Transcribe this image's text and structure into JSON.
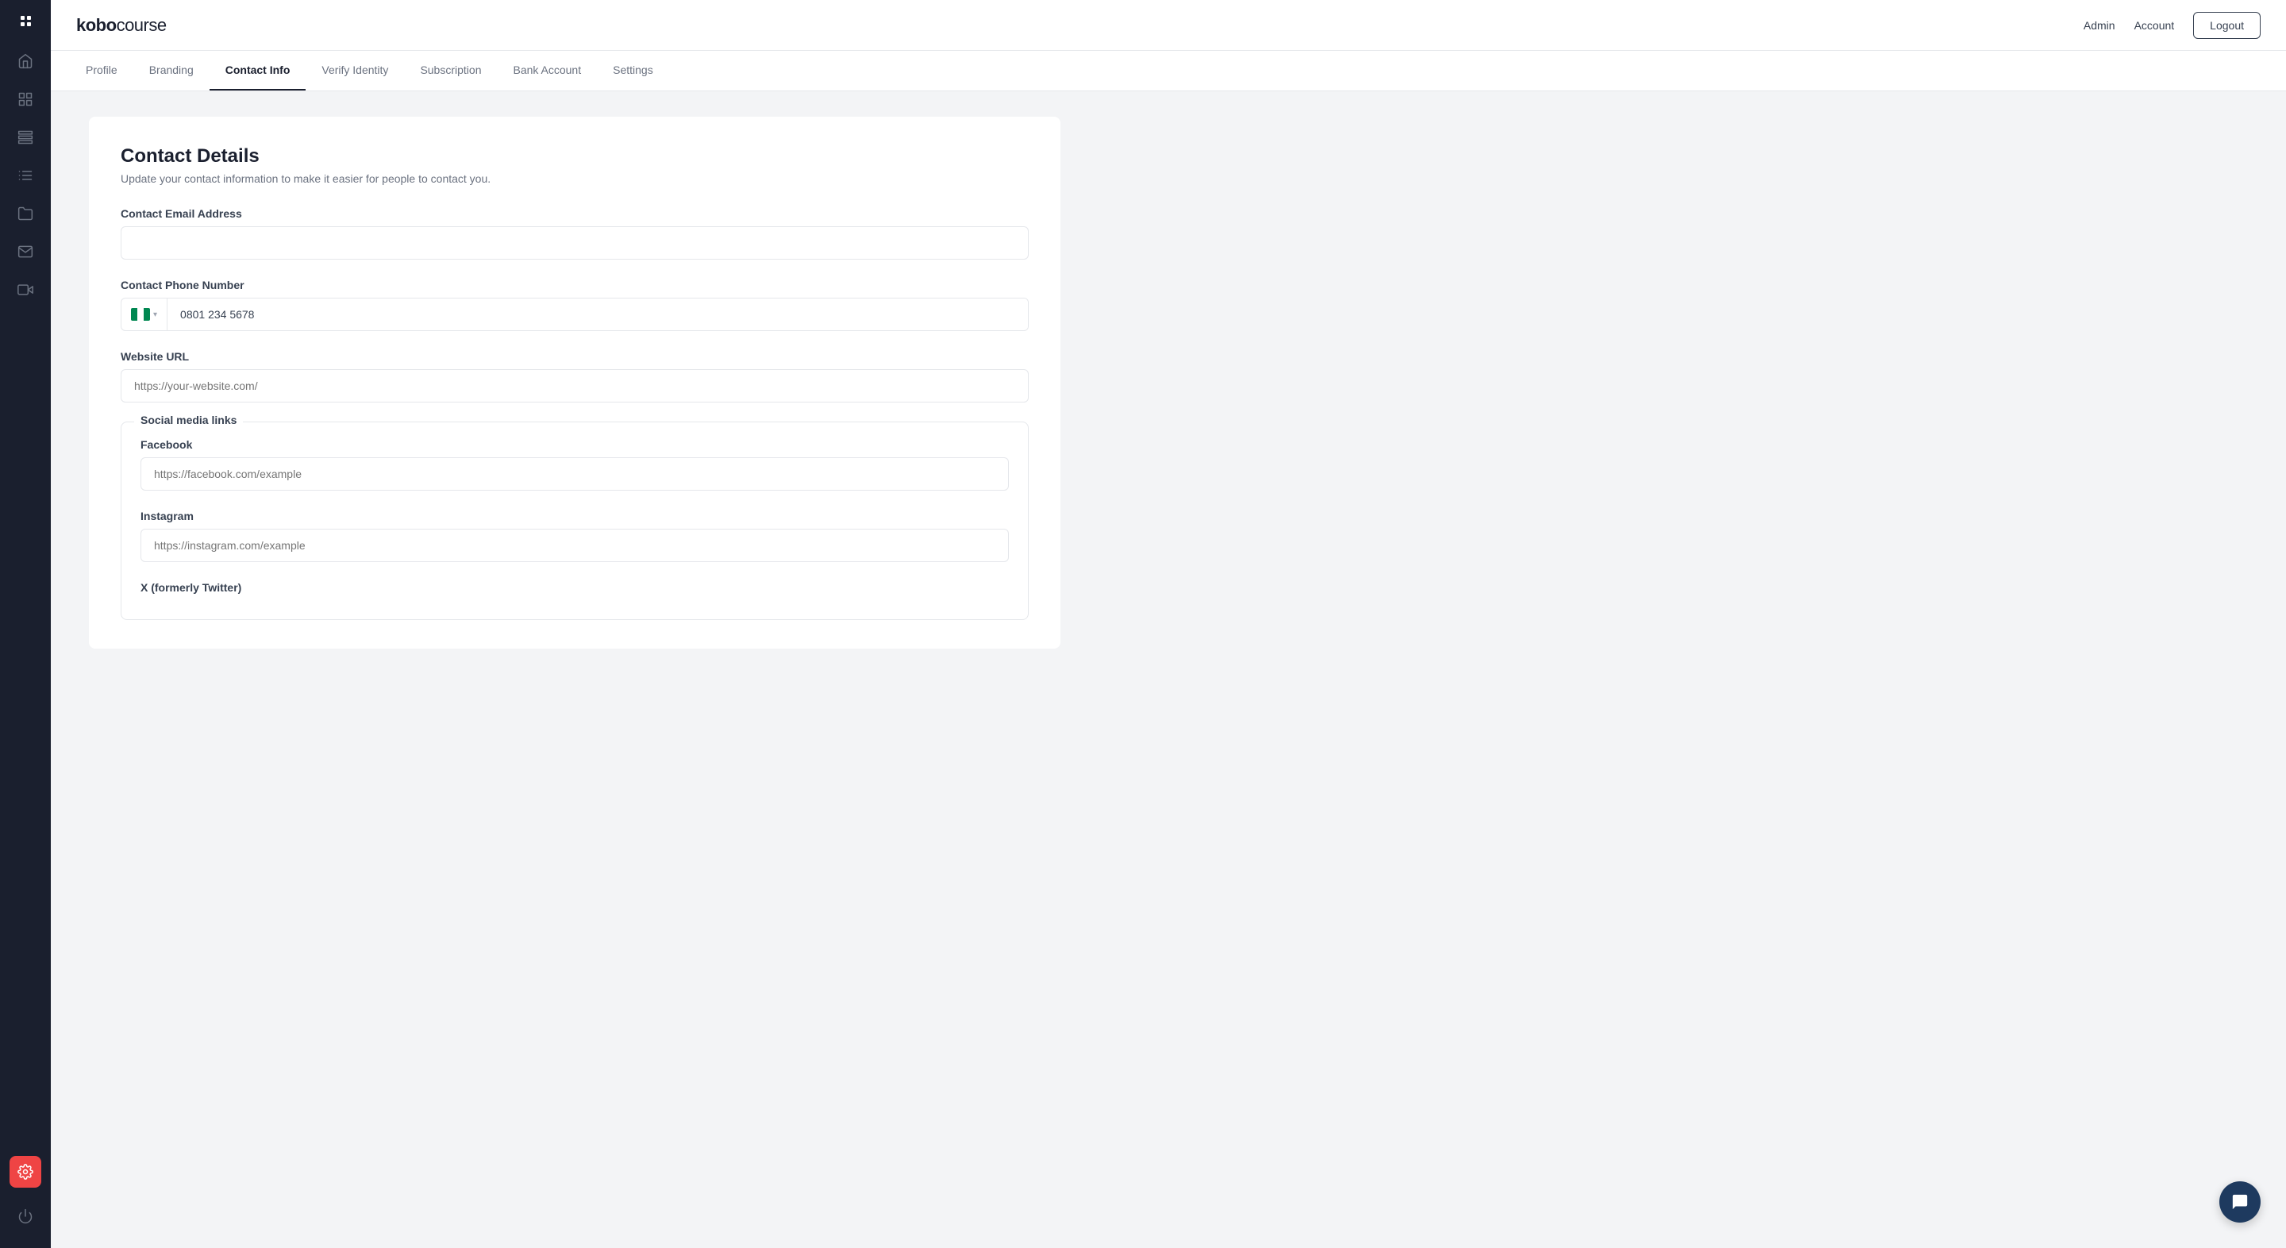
{
  "logo": {
    "brand": "kobo",
    "suffix": "course"
  },
  "topnav": {
    "admin_label": "Admin",
    "account_label": "Account",
    "logout_label": "Logout"
  },
  "tabs": [
    {
      "id": "profile",
      "label": "Profile",
      "active": false
    },
    {
      "id": "branding",
      "label": "Branding",
      "active": false
    },
    {
      "id": "contact-info",
      "label": "Contact Info",
      "active": true
    },
    {
      "id": "verify-identity",
      "label": "Verify Identity",
      "active": false
    },
    {
      "id": "subscription",
      "label": "Subscription",
      "active": false
    },
    {
      "id": "bank-account",
      "label": "Bank Account",
      "active": false
    },
    {
      "id": "settings",
      "label": "Settings",
      "active": false
    }
  ],
  "page": {
    "title": "Contact Details",
    "subtitle": "Update your contact information to make it easier for people to contact you."
  },
  "form": {
    "email_label": "Contact Email Address",
    "email_placeholder": "",
    "phone_label": "Contact Phone Number",
    "phone_value": "0801 234 5678",
    "website_label": "Website URL",
    "website_placeholder": "https://your-website.com/",
    "social_section_title": "Social media links",
    "facebook_label": "Facebook",
    "facebook_placeholder": "https://facebook.com/example",
    "instagram_label": "Instagram",
    "instagram_placeholder": "https://instagram.com/example",
    "twitter_label": "X (formerly Twitter)"
  },
  "sidebar": {
    "icons": [
      {
        "name": "home-icon",
        "symbol": "⌂"
      },
      {
        "name": "bookmark-icon",
        "symbol": "🔖"
      },
      {
        "name": "grid-icon",
        "symbol": "⊞"
      },
      {
        "name": "list-icon",
        "symbol": "≡"
      },
      {
        "name": "folder-icon",
        "symbol": "▭"
      },
      {
        "name": "mail-icon",
        "symbol": "✉"
      },
      {
        "name": "video-icon",
        "symbol": "▶"
      }
    ],
    "bottom_icon": {
      "name": "power-icon",
      "symbol": "⏻"
    }
  }
}
